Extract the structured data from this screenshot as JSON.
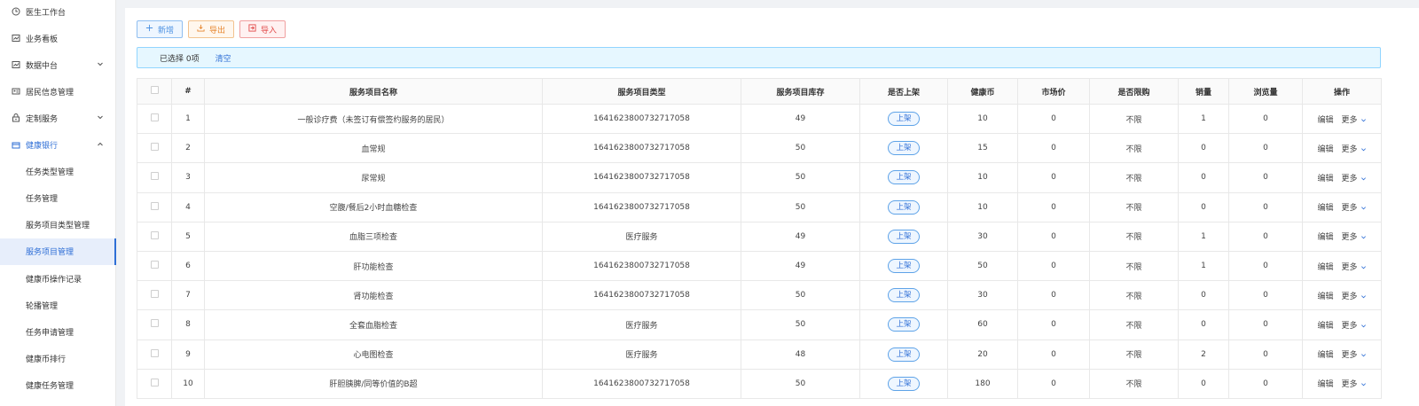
{
  "sidebar": {
    "items": [
      {
        "label": "医生工作台",
        "icon": "clock-icon",
        "type": "top"
      },
      {
        "label": "业务看板",
        "icon": "chart-icon",
        "type": "top"
      },
      {
        "label": "数据中台",
        "icon": "chart-icon",
        "type": "top",
        "chevron": "down"
      },
      {
        "label": "居民信息管理",
        "icon": "id-card-icon",
        "type": "top"
      },
      {
        "label": "定制服务",
        "icon": "lock-icon",
        "type": "top",
        "chevron": "down"
      },
      {
        "label": "健康银行",
        "icon": "bank-icon",
        "type": "open",
        "chevron": "up"
      },
      {
        "label": "任务类型管理",
        "type": "sub"
      },
      {
        "label": "任务管理",
        "type": "sub"
      },
      {
        "label": "服务项目类型管理",
        "type": "sub"
      },
      {
        "label": "服务项目管理",
        "type": "sub",
        "active": true
      },
      {
        "label": "健康币操作记录",
        "type": "sub"
      },
      {
        "label": "轮播管理",
        "type": "sub"
      },
      {
        "label": "任务申请管理",
        "type": "sub"
      },
      {
        "label": "健康币排行",
        "type": "sub"
      },
      {
        "label": "健康任务管理",
        "type": "sub"
      }
    ]
  },
  "toolbar": {
    "add_label": "新增",
    "export_label": "导出",
    "import_label": "导入"
  },
  "selection": {
    "text": "已选择 0项",
    "clear_label": "清空"
  },
  "table": {
    "headers": [
      "#",
      "服务项目名称",
      "服务项目类型",
      "服务项目库存",
      "是否上架",
      "健康币",
      "市场价",
      "是否限购",
      "销量",
      "浏览量",
      "操作"
    ],
    "edit_label": "编辑",
    "more_label": "更多",
    "rows": [
      {
        "no": "1",
        "name": "一般诊疗费（未签订有偿签约服务的居民）",
        "type": "1641623800732717058",
        "stock": "49",
        "status": "上架",
        "coin": "10",
        "price": "0",
        "limit": "不限",
        "sales": "1",
        "views": "0"
      },
      {
        "no": "2",
        "name": "血常规",
        "type": "1641623800732717058",
        "stock": "50",
        "status": "上架",
        "coin": "15",
        "price": "0",
        "limit": "不限",
        "sales": "0",
        "views": "0"
      },
      {
        "no": "3",
        "name": "尿常规",
        "type": "1641623800732717058",
        "stock": "50",
        "status": "上架",
        "coin": "10",
        "price": "0",
        "limit": "不限",
        "sales": "0",
        "views": "0"
      },
      {
        "no": "4",
        "name": "空腹/餐后2小时血糖检查",
        "type": "1641623800732717058",
        "stock": "50",
        "status": "上架",
        "coin": "10",
        "price": "0",
        "limit": "不限",
        "sales": "0",
        "views": "0"
      },
      {
        "no": "5",
        "name": "血脂三项检查",
        "type": "医疗服务",
        "stock": "49",
        "status": "上架",
        "coin": "30",
        "price": "0",
        "limit": "不限",
        "sales": "1",
        "views": "0"
      },
      {
        "no": "6",
        "name": "肝功能检查",
        "type": "1641623800732717058",
        "stock": "49",
        "status": "上架",
        "coin": "50",
        "price": "0",
        "limit": "不限",
        "sales": "1",
        "views": "0"
      },
      {
        "no": "7",
        "name": "肾功能检查",
        "type": "1641623800732717058",
        "stock": "50",
        "status": "上架",
        "coin": "30",
        "price": "0",
        "limit": "不限",
        "sales": "0",
        "views": "0"
      },
      {
        "no": "8",
        "name": "全套血脂检查",
        "type": "医疗服务",
        "stock": "50",
        "status": "上架",
        "coin": "60",
        "price": "0",
        "limit": "不限",
        "sales": "0",
        "views": "0"
      },
      {
        "no": "9",
        "name": "心电图检查",
        "type": "医疗服务",
        "stock": "48",
        "status": "上架",
        "coin": "20",
        "price": "0",
        "limit": "不限",
        "sales": "2",
        "views": "0"
      },
      {
        "no": "10",
        "name": "肝胆胰脾/同等价值的B超",
        "type": "1641623800732717058",
        "stock": "50",
        "status": "上架",
        "coin": "180",
        "price": "0",
        "limit": "不限",
        "sales": "0",
        "views": "0"
      }
    ]
  }
}
